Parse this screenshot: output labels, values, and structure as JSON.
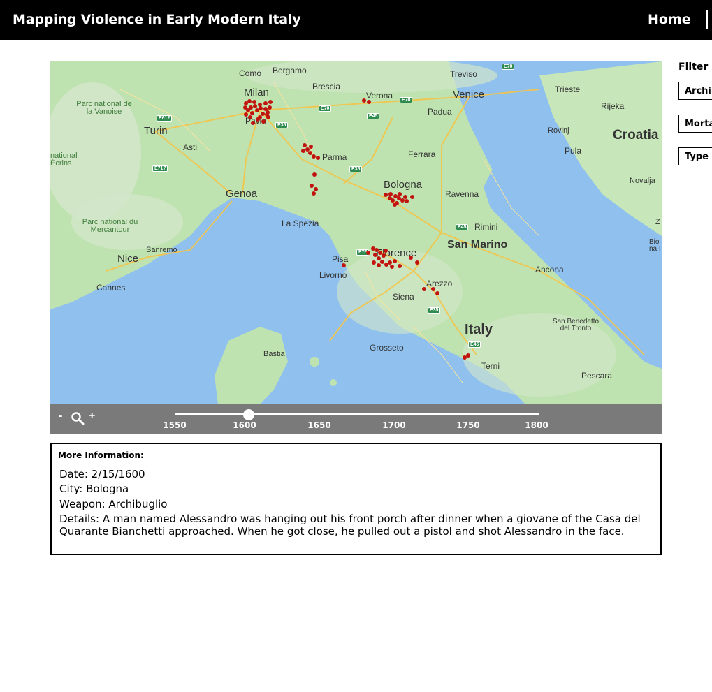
{
  "header": {
    "title": "Mapping Violence in Early Modern Italy",
    "nav_home": "Home"
  },
  "map": {
    "cities": [
      {
        "name": "Como"
      },
      {
        "name": "Bergamo"
      },
      {
        "name": "Milan"
      },
      {
        "name": "Brescia"
      },
      {
        "name": "Treviso"
      },
      {
        "name": "Verona"
      },
      {
        "name": "Venice"
      },
      {
        "name": "Trieste"
      },
      {
        "name": "Padua"
      },
      {
        "name": "Rijeka"
      },
      {
        "name": "Turin"
      },
      {
        "name": "Asti"
      },
      {
        "name": "Pavia"
      },
      {
        "name": "Parma"
      },
      {
        "name": "Ferrara"
      },
      {
        "name": "Rovinj"
      },
      {
        "name": "Pula"
      },
      {
        "name": "Croatia"
      },
      {
        "name": "Genoa"
      },
      {
        "name": "Bologna"
      },
      {
        "name": "Ravenna"
      },
      {
        "name": "Novalja"
      },
      {
        "name": "La Spezia"
      },
      {
        "name": "Rimini"
      },
      {
        "name": "San Marino"
      },
      {
        "name": "Nice"
      },
      {
        "name": "Sanremo"
      },
      {
        "name": "Pisa"
      },
      {
        "name": "Florence"
      },
      {
        "name": "Livorno"
      },
      {
        "name": "Cannes"
      },
      {
        "name": "Ancona"
      },
      {
        "name": "Arezzo"
      },
      {
        "name": "Siena"
      },
      {
        "name": "Italy"
      },
      {
        "name": "San Benedetto del Tronto"
      },
      {
        "name": "Grosseto"
      },
      {
        "name": "Bastia"
      },
      {
        "name": "Terni"
      },
      {
        "name": "Pescara"
      }
    ],
    "parks": [
      "Parc national de la Vanoise",
      "national Écrins",
      "Parc national du Mercantour"
    ],
    "road_shields": [
      "E70",
      "E612",
      "E70",
      "E45",
      "E70",
      "E35",
      "E717",
      "E35",
      "E45",
      "E76",
      "E35",
      "E45"
    ],
    "edge_labels": [
      "Z",
      "Bio na I"
    ],
    "event_marker_color": "#c1140f"
  },
  "timeline": {
    "zoom_out": "-",
    "zoom_in": "+",
    "ticks": [
      "1550",
      "1600",
      "1650",
      "1700",
      "1750",
      "1800"
    ],
    "range": [
      1550,
      1800
    ],
    "selected_year": 1600
  },
  "info": {
    "title": "More Information:",
    "date": "Date: 2/15/1600",
    "city": "City: Bologna",
    "weapon": "Weapon: Archibuglio",
    "details": "Details: A man named Alessandro was hanging out his front porch after dinner when a giovane of the Casa del Quarante Bianchetti approached. When he got close, he pulled out a pistol and shot Alessandro in the face."
  },
  "filters": {
    "title": "Filter b",
    "buttons": [
      "Archil",
      "Morta",
      "Type c"
    ]
  },
  "colors": {
    "topbar": "#000000",
    "timeline_bar": "#7a7a7a",
    "water": "#8fc0ee",
    "land": "#bfe3b0"
  }
}
